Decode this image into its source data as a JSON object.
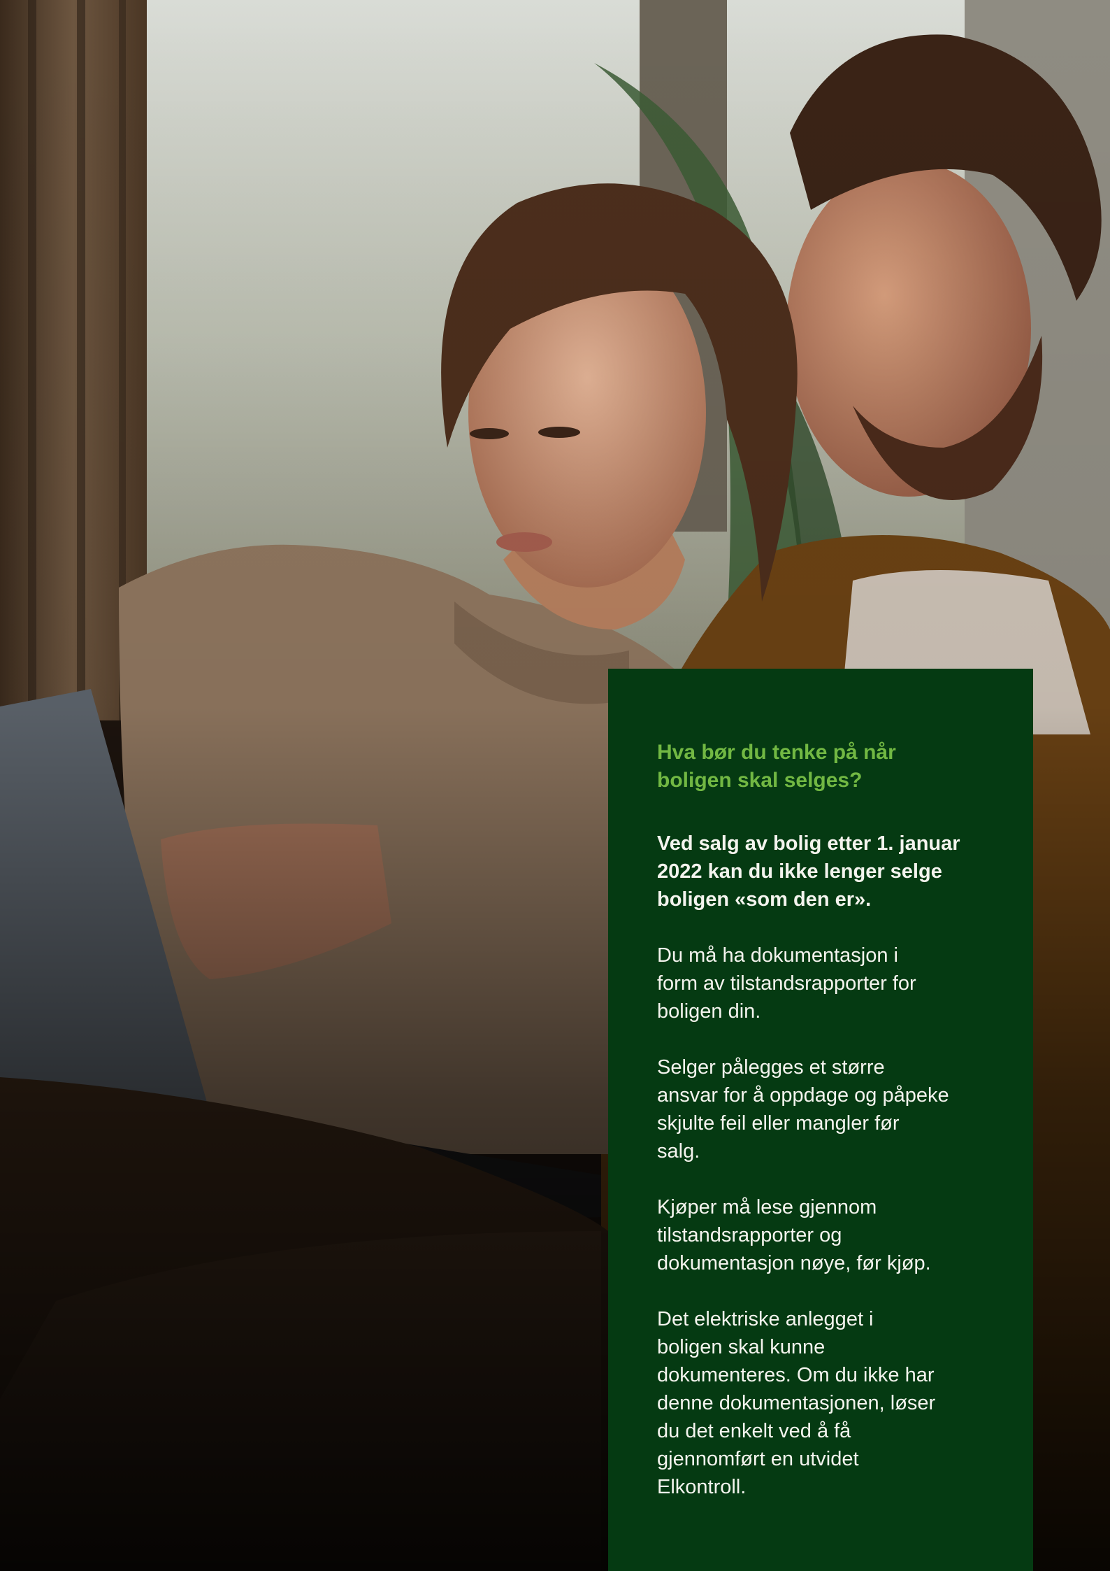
{
  "image": {
    "description_icon": "photo-couple-laptop",
    "colors": {
      "panel_bg": "#053a12",
      "heading": "#72b843",
      "text": "#f4f4ee"
    }
  },
  "panel": {
    "heading": "Hva bør du tenke på når\nboligen skal selges?",
    "paragraphs": [
      "Ved salg av bolig etter 1. januar\n2022 kan du ikke lenger selge\nboligen «som den er».",
      "Du må ha dokumentasjon i\nform av tilstandsrapporter for\nboligen din.",
      "Selger pålegges et større\nansvar for å oppdage og påpeke\nskjulte feil eller mangler før\nsalg.",
      "Kjøper må lese gjennom\ntilstandsrapporter og\ndokumentasjon nøye, før kjøp.",
      "Det elektriske anlegget i\nboligen skal kunne\ndokumenteres. Om du ikke har\ndenne dokumentasjonen, løser\ndu det enkelt ved å få\ngjennomført en utvidet\nElkontroll."
    ]
  }
}
